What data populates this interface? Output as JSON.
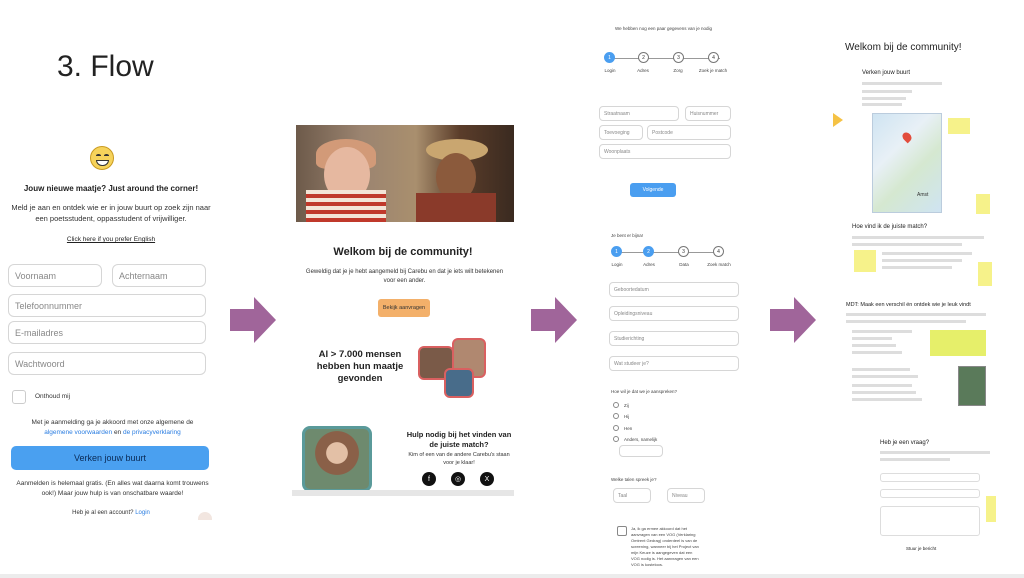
{
  "slide": {
    "title": "3. Flow"
  },
  "panel1": {
    "heading": "Jouw nieuwe maatje? Just around the corner!",
    "subtext": "Meld je aan en ontdek wie er in jouw buurt op zoek zijn naar een poetsstudent, oppasstudent of vrijwilliger.",
    "english_link": "Click here if you prefer English",
    "fields": {
      "first_name": "Voornaam",
      "last_name": "Achternaam",
      "phone": "Telefoonnummer",
      "email": "E-mailadres",
      "password": "Wachtwoord"
    },
    "remember": "Onthoud mij",
    "legal_prefix": "Met je aanmelding ga je akkoord met onze algemene de",
    "legal_terms": "algemene voorwaarden",
    "legal_and": "en",
    "legal_privacy": "de privacyverklaring",
    "cta": "Verken jouw buurt",
    "free_note": "Aanmelden is helemaal gratis. (En alles wat daarna komt trouwens ook!) Maar jouw hulp is van onschatbare waarde!",
    "account_prefix": "Heb je al een account?",
    "login_link": "Login"
  },
  "panel2": {
    "heading": "Welkom bij de community!",
    "subtext": "Geweldig dat je je hebt aangemeld bij Carebu en dat je iets wilt betekenen voor een ander.",
    "button": "Bekijk aanvragen",
    "stat": "Al > 7.000 mensen hebben hun maatje gevonden",
    "help_heading": "Hulp nodig bij het vinden van de juiste match?",
    "help_sub": "Kim of een van de andere Carebu's staan voor je klaar!",
    "social": [
      "f",
      "◎",
      "X"
    ]
  },
  "panel3": {
    "top_note": "We hebben nog een paar gegevens van je nodig",
    "steps_a": [
      {
        "num": "1",
        "label": "Login"
      },
      {
        "num": "2",
        "label": "Adres"
      },
      {
        "num": "3",
        "label": "Zorg"
      },
      {
        "num": "4",
        "label": "Zoek je match"
      }
    ],
    "address_fields": {
      "street": "Straatnaam",
      "house_number": "Huisnummer",
      "addition": "Toevoeging",
      "postcode": "Postcode",
      "city": "Woonplaats"
    },
    "next_button": "Volgende",
    "section_b_note": "Je bent er bijna!",
    "steps_b": [
      {
        "num": "1",
        "label": "Login"
      },
      {
        "num": "2",
        "label": "Adres"
      },
      {
        "num": "3",
        "label": "Data"
      },
      {
        "num": "4",
        "label": "Zoek match"
      }
    ],
    "data_fields": {
      "birthdate": "Geboortedatum",
      "education": "Opleidingsniveau",
      "study": "Studierichting",
      "what_study": "Wat studeer je?"
    },
    "pronoun_question": "Hoe wil je dat we je aanspreken?",
    "pronouns": [
      "Zij",
      "Hij",
      "Hen",
      "Anders, namelijk"
    ],
    "language_question": "Welke talen spreek je?",
    "lang_fields": {
      "language": "Taal",
      "level": "Niveau"
    },
    "consent": "Ja, ik ga ermee akkoord dat het aanvragen van een VOG (Verklaring Omtrent Gedrag) onderdeel is van de screening, wanneer bij het Project van mijn Keuze is aangegeven dat een VOG nodig is. Het aanvragen van een VOG is kosteloos."
  },
  "panel4": {
    "heading": "Welkom bij de community!",
    "explore": "Verken jouw buurt",
    "map_label": "Amst",
    "match_heading": "Hoe vind ik de juiste match?",
    "mdt_heading": "MDT: Maak een verschil én ontdek wie je leuk vindt",
    "contact_heading": "Heb je een vraag?",
    "send_button": "Stuur je bericht"
  },
  "colors": {
    "accent_blue": "#4a9ef0",
    "arrow": "#a0659a",
    "orange": "#f3b06a",
    "sticky": "#f6f28a"
  }
}
